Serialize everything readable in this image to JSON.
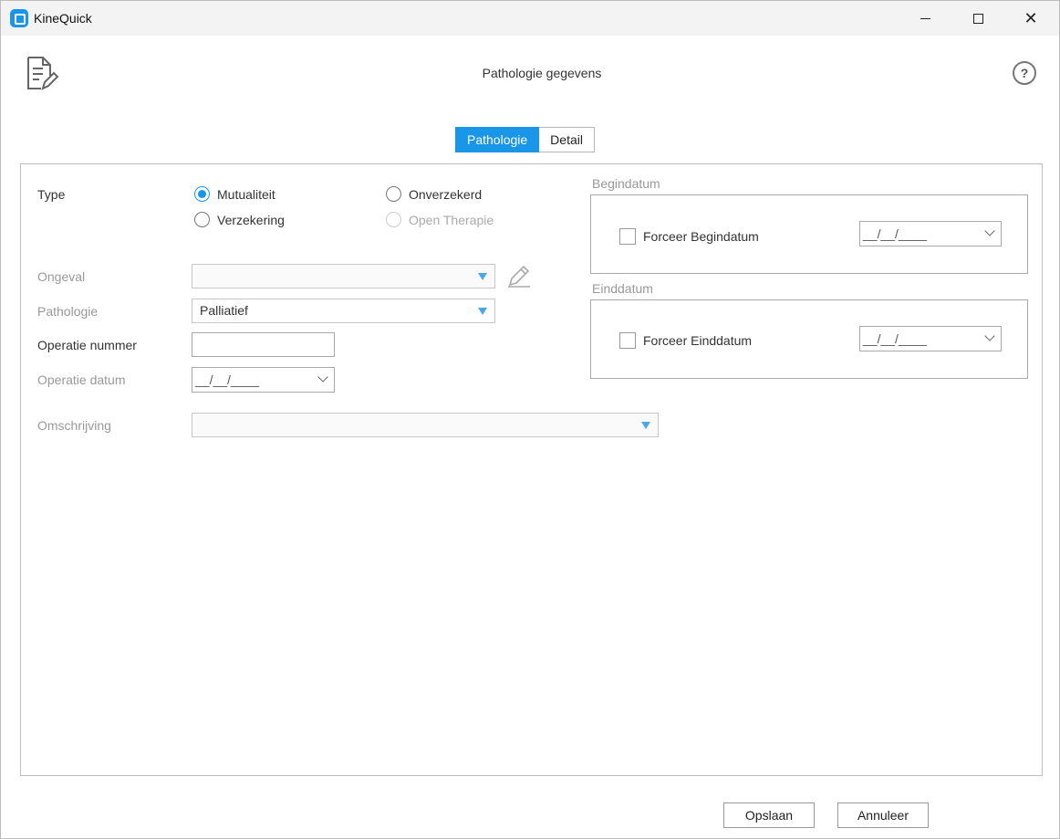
{
  "window": {
    "title": "KineQuick"
  },
  "header": {
    "title": "Pathologie gegevens",
    "help_glyph": "?"
  },
  "tabs": [
    {
      "label": "Pathologie",
      "active": true
    },
    {
      "label": "Detail",
      "active": false
    }
  ],
  "type": {
    "label": "Type",
    "options": [
      {
        "label": "Mutualiteit",
        "checked": true,
        "enabled": true
      },
      {
        "label": "Onverzekerd",
        "checked": false,
        "enabled": true
      },
      {
        "label": "Verzekering",
        "checked": false,
        "enabled": true
      },
      {
        "label": "Open Therapie",
        "checked": false,
        "enabled": false
      }
    ]
  },
  "fields": {
    "ongeval": {
      "label": "Ongeval",
      "value": ""
    },
    "pathologie": {
      "label": "Pathologie",
      "value": "Palliatief"
    },
    "operatie_nummer": {
      "label": "Operatie nummer",
      "value": ""
    },
    "operatie_datum": {
      "label": "Operatie datum",
      "value": "__/__/____"
    },
    "omschrijving": {
      "label": "Omschrijving",
      "value": ""
    }
  },
  "begindatum": {
    "title": "Begindatum",
    "checkbox_label": "Forceer Begindatum",
    "checked": false,
    "date_value": "__/__/____"
  },
  "einddatum": {
    "title": "Einddatum",
    "checkbox_label": "Forceer Einddatum",
    "checked": false,
    "date_value": "__/__/____"
  },
  "buttons": {
    "save": "Opslaan",
    "cancel": "Annuleer"
  },
  "colors": {
    "accent": "#1a96e8",
    "dropdown_arrow": "#4aa8e8",
    "disabled_text": "#999999"
  }
}
